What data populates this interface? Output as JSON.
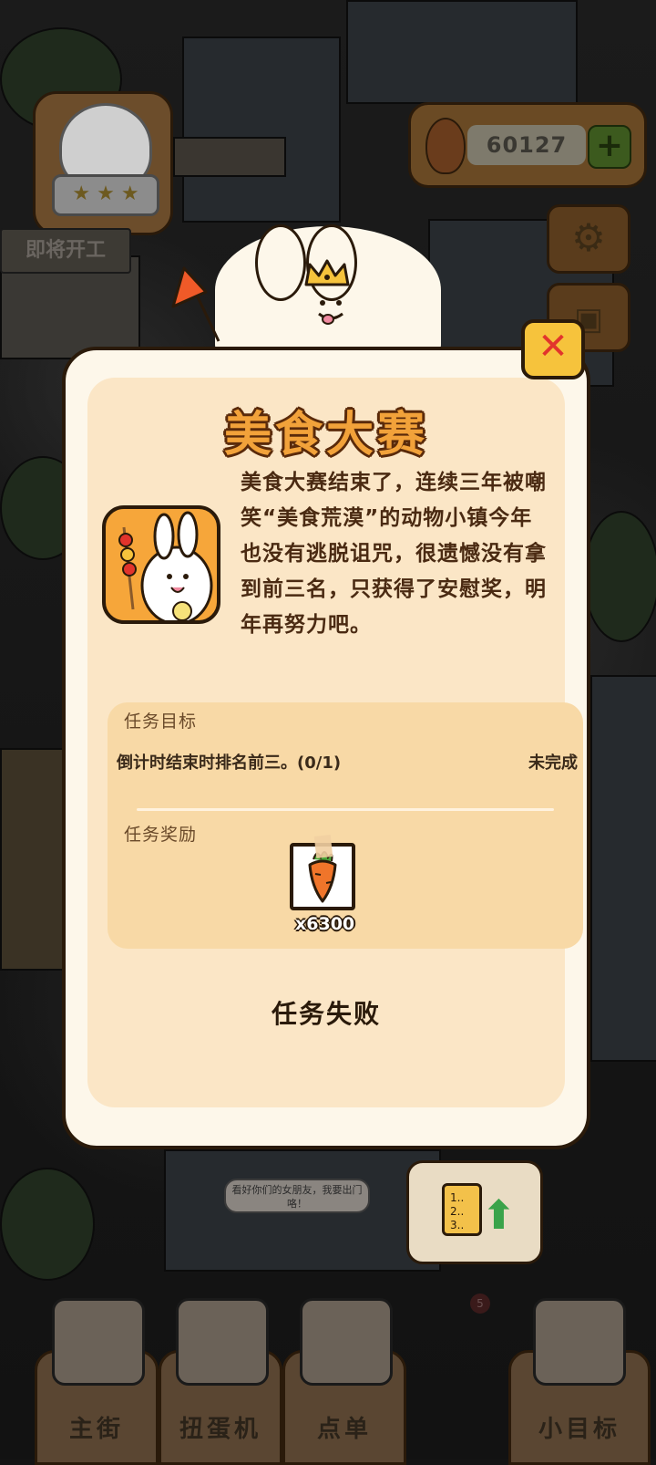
{
  "hud": {
    "currency_value": "60127",
    "coming_soon_label": "即将开工",
    "add_symbol": "+"
  },
  "modal": {
    "title": "美食大赛",
    "story": "美食大赛结束了，连续三年被嘲笑“美食荒漠”的动物小镇今年也没有逃脱诅咒，很遗憾没有拿到前三名，只获得了安慰奖，明年再努力吧。",
    "objective_label": "任务目标",
    "objective_text": "倒计时结束时排名前三。(0/1)",
    "objective_status": "未完成",
    "reward_label": "任务奖励",
    "reward_quantity": "x6300",
    "result_text": "任务失败",
    "close_symbol": "✕"
  },
  "speech_bubble": "看好你们的女朋友，我要出门咯！",
  "nav": {
    "tabs": [
      {
        "label": "主街"
      },
      {
        "label": "扭蛋机"
      },
      {
        "label": "点单"
      },
      {
        "label": "小目标"
      }
    ],
    "badge_count": "5"
  },
  "icons": [
    "carrot-icon",
    "plus-icon",
    "gear-icon",
    "gift-icon",
    "close-icon",
    "clipboard-icon",
    "upload-arrow-icon",
    "flag-icon",
    "crown-icon"
  ],
  "colors": {
    "title_orange": "#f2a23a",
    "modal_cream": "#fdf7ea",
    "panel_peach": "#fbe6c6",
    "task_box": "#f8d9a6",
    "close_yellow": "#f6c33c",
    "close_red": "#e2342c",
    "carrot_orange": "#f0752a"
  }
}
